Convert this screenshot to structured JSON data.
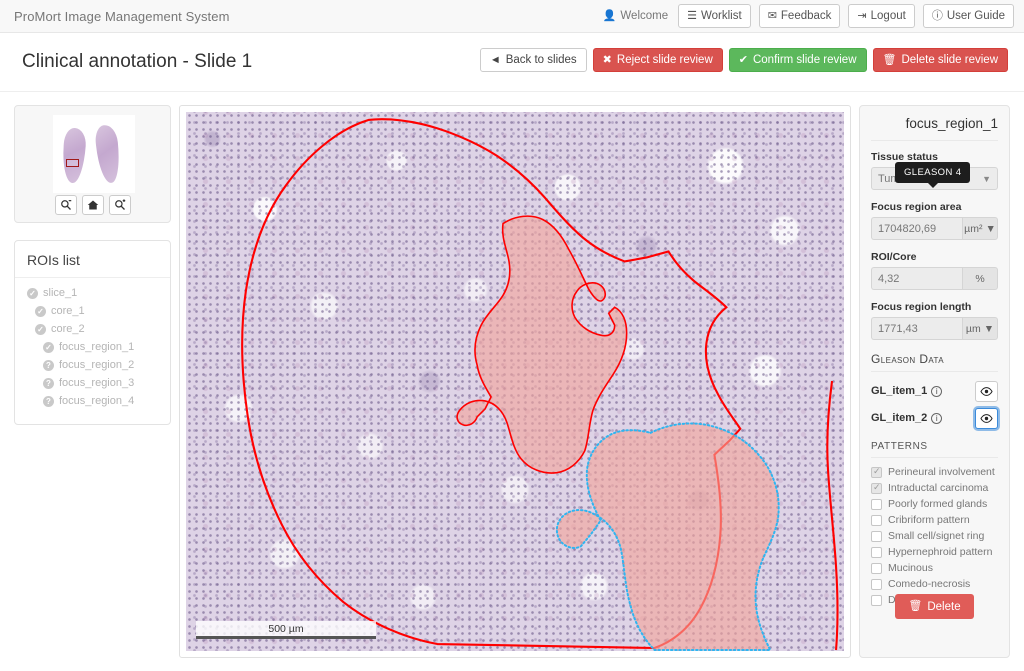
{
  "navbar": {
    "brand": "ProMort Image Management System",
    "welcome": "Welcome",
    "welcome_icon": "user-icon",
    "buttons": [
      {
        "label": "Worklist",
        "icon": "list-icon"
      },
      {
        "label": "Feedback",
        "icon": "envelope-icon"
      },
      {
        "label": "Logout",
        "icon": "sign-out-icon"
      },
      {
        "label": "User Guide",
        "icon": "info-circle-icon"
      }
    ]
  },
  "page": {
    "title": "Clinical annotation - Slide 1",
    "actions": [
      {
        "label": "Back to slides",
        "icon": "arrow-left-icon",
        "style": "default"
      },
      {
        "label": "Reject slide review",
        "icon": "times-circle-icon",
        "style": "danger"
      },
      {
        "label": "Confirm slide review",
        "icon": "check-circle-icon",
        "style": "success"
      },
      {
        "label": "Delete slide review",
        "icon": "trash-icon",
        "style": "danger"
      }
    ]
  },
  "thumbnail": {
    "controls": [
      {
        "name": "zoom-out-button",
        "icon": "magnifier-minus-icon"
      },
      {
        "name": "home-button",
        "icon": "home-icon"
      },
      {
        "name": "zoom-in-button",
        "icon": "magnifier-plus-icon"
      }
    ]
  },
  "rois": {
    "title": "ROIs list",
    "items": [
      {
        "label": "slice_1",
        "level": 0,
        "icon": "check-circle-icon"
      },
      {
        "label": "core_1",
        "level": 1,
        "icon": "check-circle-icon"
      },
      {
        "label": "core_2",
        "level": 1,
        "icon": "check-circle-icon"
      },
      {
        "label": "focus_region_1",
        "level": 2,
        "icon": "check-circle-icon"
      },
      {
        "label": "focus_region_2",
        "level": 2,
        "icon": "question-circle-icon"
      },
      {
        "label": "focus_region_3",
        "level": 2,
        "icon": "question-circle-icon"
      },
      {
        "label": "focus_region_4",
        "level": 2,
        "icon": "question-circle-icon"
      }
    ]
  },
  "viewer": {
    "scalebar_label": "500 µm",
    "annotations": [
      {
        "name": "core-outline",
        "color": "#ff0000",
        "style": "solid"
      },
      {
        "name": "focus-region-1-fill",
        "color": "#f4a49a",
        "style": "solid"
      },
      {
        "name": "focus-region-2-fill",
        "color": "#f4a49a",
        "style": "dotted-blue"
      }
    ],
    "colors": {
      "outline": "#ff0000",
      "selected_outline": "#2fb5f0",
      "region_fill": "#f4a49a"
    }
  },
  "details": {
    "title": "focus_region_1",
    "tissue_status": {
      "label": "Tissue status",
      "value": "Tumor"
    },
    "area": {
      "label": "Focus region area",
      "value": "1704820,69",
      "unit": "µm²"
    },
    "roi_core": {
      "label": "ROI/Core",
      "value": "4,32",
      "unit": "%"
    },
    "length": {
      "label": "Focus region length",
      "value": "1771,43",
      "unit": "µm"
    },
    "gleason": {
      "header": "Gleason Data",
      "tooltip": "GLEASON 4",
      "items": [
        {
          "label": "GL_item_1",
          "info_icon": "info-circle-icon",
          "eye_icon": "eye-icon",
          "focused": false
        },
        {
          "label": "GL_item_2",
          "info_icon": "info-circle-icon",
          "eye_icon": "eye-icon",
          "focused": true
        }
      ]
    },
    "patterns": {
      "header": "PATTERNS",
      "items": [
        {
          "label": "Perineural involvement",
          "checked": true
        },
        {
          "label": "Intraductal carcinoma",
          "checked": true
        },
        {
          "label": "Poorly formed glands",
          "checked": false
        },
        {
          "label": "Cribriform pattern",
          "checked": false
        },
        {
          "label": "Small cell/signet ring",
          "checked": false
        },
        {
          "label": "Hypernephroid pattern",
          "checked": false
        },
        {
          "label": "Mucinous",
          "checked": false
        },
        {
          "label": "Comedo-necrosis",
          "checked": false
        },
        {
          "label": "Ductal carcinoma",
          "checked": false
        }
      ]
    },
    "delete_button": {
      "label": "Delete",
      "icon": "trash-icon"
    }
  }
}
